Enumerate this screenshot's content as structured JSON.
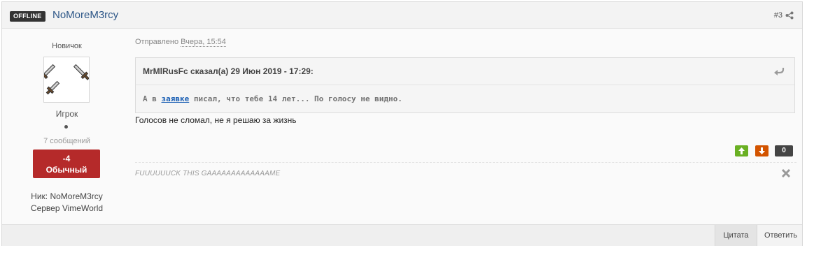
{
  "header": {
    "status_badge": "OFFLINE",
    "author": "NoMoreM3rcy",
    "post_number": "#3"
  },
  "sidebar": {
    "rank": "Новичок",
    "group": "Игрок",
    "posts_count": "7 сообщений",
    "reputation_value": "-4",
    "reputation_label": "Обычный",
    "nick": "Ник: NoMoreM3rcy",
    "server": "Сервер VimeWorld"
  },
  "post": {
    "posted_prefix": "Отправлено ",
    "posted_date": "Вчера, 15:54",
    "quote": {
      "citation": "MrMlRusFc сказал(а) 29 Июн 2019 - 17:29:",
      "text_before": "А в ",
      "link_text": "заявке",
      "text_after": " писал, что тебе 14 лет... По голосу не видно."
    },
    "message": "Голосов не сломал, не я решаю за жизнь",
    "vote_count": "0",
    "signature": "FUUUUUUCK THIS GAAAAAAAAAAAAAME"
  },
  "footer": {
    "quote_button": "Цитата",
    "reply_button": "Ответить"
  },
  "icons": {
    "share": "share-icon",
    "vote_up": "arrow-up-icon",
    "vote_down": "arrow-down-icon",
    "quote_reply": "reply-arrow-icon",
    "signature_close": "close-icon"
  },
  "colors": {
    "author_link": "#2c5687",
    "reputation_negative": "#b52a2a",
    "vote_up": "#6ab023",
    "vote_down": "#d35400",
    "quote_link": "#1a5fb4"
  }
}
